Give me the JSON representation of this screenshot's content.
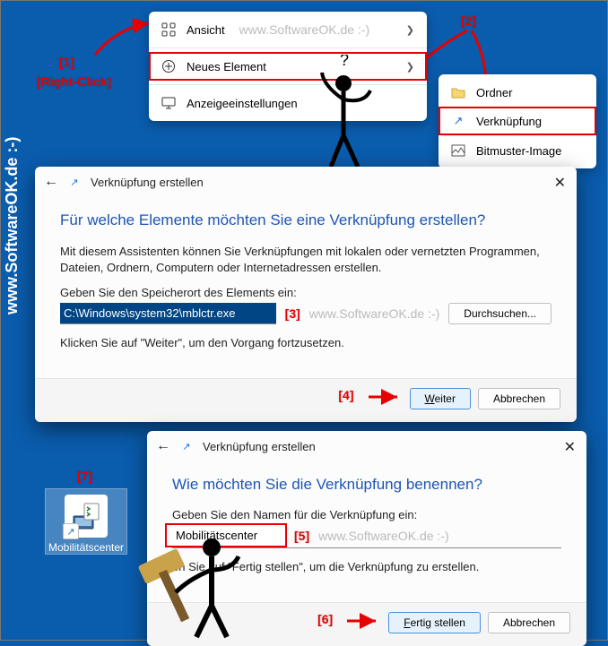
{
  "site": {
    "watermark": "www.SoftwareOK.de :-)"
  },
  "annot": {
    "n1": "[1]",
    "n1_sub": "[Right-Click]",
    "n2": "[2]",
    "n3": "[3]",
    "n4": "[4]",
    "n5": "[5]",
    "n6": "[6]",
    "n7": "[7]"
  },
  "context_menu": {
    "view": "Ansicht",
    "new_element": "Neues Element",
    "display_settings": "Anzeigeeinstellungen"
  },
  "sub_menu": {
    "folder": "Ordner",
    "shortcut": "Verknüpfung",
    "bitmap": "Bitmuster-Image"
  },
  "dialog1": {
    "title": "Verknüpfung erstellen",
    "heading": "Für welche Elemente möchten Sie eine Verknüpfung erstellen?",
    "intro": "Mit diesem Assistenten können Sie Verknüpfungen mit lokalen oder vernetzten Programmen, Dateien, Ordnern, Computern oder Internetadressen erstellen.",
    "label": "Geben Sie den Speicherort des Elements ein:",
    "value": "C:\\Windows\\system32\\mblctr.exe",
    "browse": "Durchsuchen...",
    "hint": "Klicken Sie auf \"Weiter\", um den Vorgang fortzusetzen.",
    "next": "Weiter",
    "cancel": "Abbrechen"
  },
  "dialog2": {
    "title": "Verknüpfung erstellen",
    "heading": "Wie möchten Sie die Verknüpfung benennen?",
    "label": "Geben Sie den Namen für die Verknüpfung ein:",
    "value": "Mobilitätscenter",
    "hint_prefix": "en Sie auf \"Fertig stellen\", um die Verknüpfung zu erstellen.",
    "finish": "Fertig stellen",
    "cancel": "Abbrechen"
  },
  "shortcut": {
    "label": "Mobilitätscenter"
  }
}
